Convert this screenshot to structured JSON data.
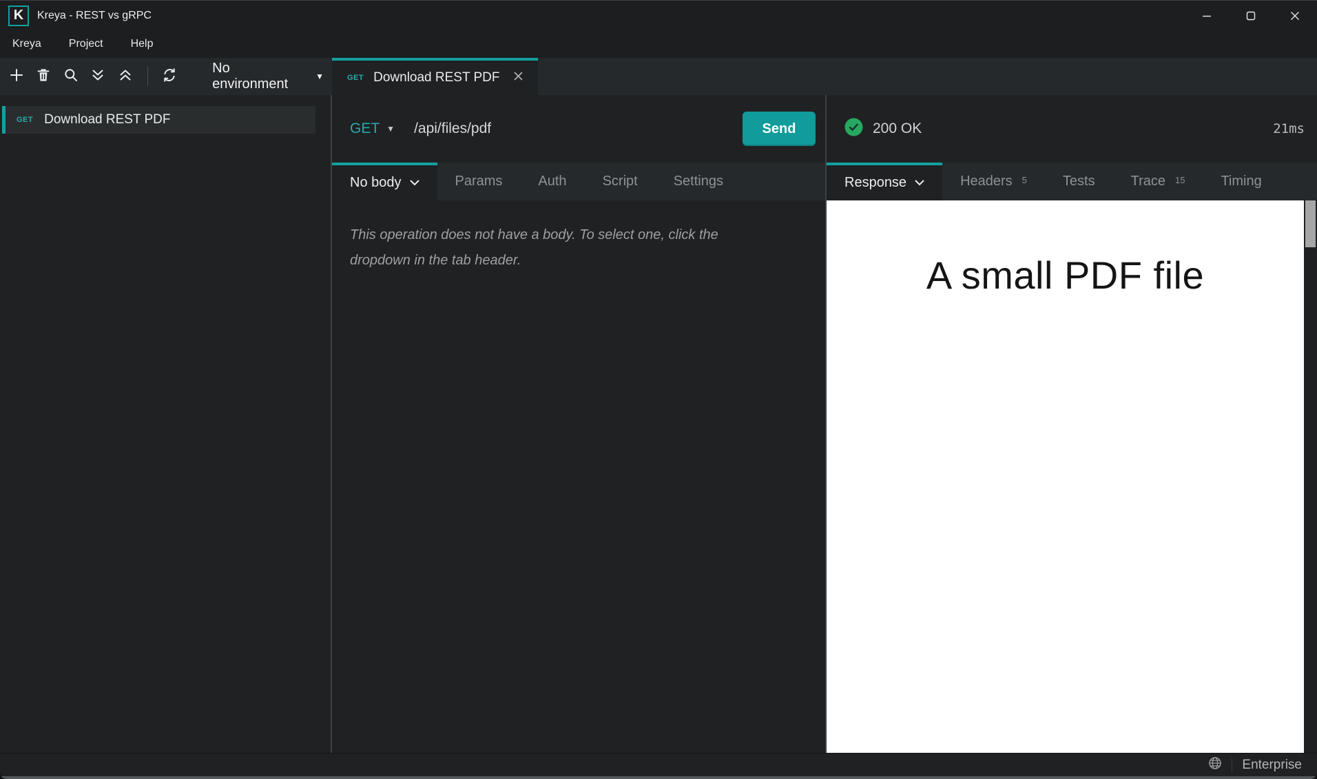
{
  "window": {
    "logo_letter": "K",
    "title": "Kreya - REST vs gRPC"
  },
  "menu": {
    "items": [
      "Kreya",
      "Project",
      "Help"
    ]
  },
  "toolbar": {
    "environment_label": "No environment"
  },
  "sidebar": {
    "items": [
      {
        "method": "GET",
        "name": "Download REST PDF"
      }
    ]
  },
  "doc_tabs": [
    {
      "method": "GET",
      "title": "Download REST PDF"
    }
  ],
  "request": {
    "method": "GET",
    "url": "/api/files/pdf",
    "send_label": "Send",
    "tabs": [
      {
        "label": "No body"
      },
      {
        "label": "Params"
      },
      {
        "label": "Auth"
      },
      {
        "label": "Script"
      },
      {
        "label": "Settings"
      }
    ],
    "body_hint": "This operation does not have a body. To select one, click the dropdown in the tab header."
  },
  "response": {
    "status": "200 OK",
    "duration": "21ms",
    "tabs": [
      {
        "label": "Response"
      },
      {
        "label": "Headers",
        "badge": "5"
      },
      {
        "label": "Tests"
      },
      {
        "label": "Trace",
        "badge": "15"
      },
      {
        "label": "Timing"
      }
    ],
    "preview_text": "A small PDF file"
  },
  "statusbar": {
    "license_label": "Enterprise"
  },
  "colors": {
    "accent_teal": "#14a0a0",
    "send_button": "#119b9b",
    "success_green": "#27a860"
  },
  "icons": {
    "add": "plus",
    "delete": "trash-can",
    "search": "magnifier",
    "expand_all": "double-chevron-down",
    "collapse_all": "double-chevron-up",
    "refresh": "circular-arrows",
    "dropdown_caret": "▼",
    "tab_close": "×",
    "status_ok": "check-circle",
    "globe": "globe",
    "minimize": "–",
    "maximize": "□",
    "close": "×"
  }
}
